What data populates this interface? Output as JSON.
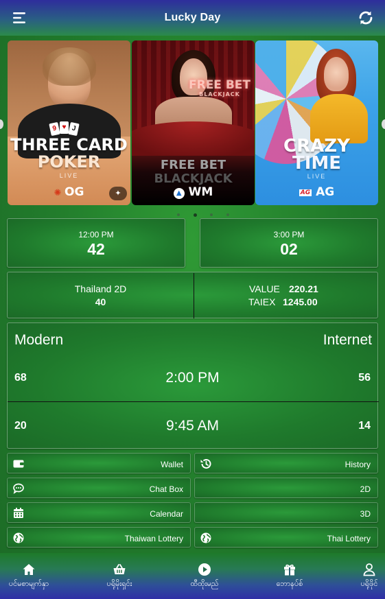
{
  "header": {
    "title": "Lucky Day"
  },
  "banner": {
    "cards": [
      {
        "title_line1": "THREE CARD",
        "title_line2": "POKER",
        "sub": "LIVE",
        "brand": "OG"
      },
      {
        "title_line1": "FREE BET",
        "title_line2": "BLACKJACK",
        "sign": "FREE BET",
        "sign_sub": "BLACKJACK",
        "brand": "WM"
      },
      {
        "title_line1": "CRAZY",
        "title_line2": "TIME",
        "sub": "LIVE",
        "brand_prefix": "AG",
        "brand": "AG"
      }
    ],
    "active_dot": 1,
    "dot_count": 4
  },
  "results": [
    {
      "time": "12:00 PM",
      "number": "42"
    },
    {
      "time": "3:00 PM",
      "number": "02"
    }
  ],
  "info": {
    "left_label": "Thailand 2D",
    "left_value": "40",
    "value_label": "VALUE",
    "value_number": "220.21",
    "taiex_label": "TAIEX",
    "taiex_number": "1245.00"
  },
  "draws": {
    "left_header": "Modern",
    "right_header": "Internet",
    "rows": [
      {
        "left": "68",
        "time": "2:00 PM",
        "right": "56"
      },
      {
        "left": "20",
        "time": "9:45 AM",
        "right": "14"
      }
    ]
  },
  "menu": [
    {
      "label": "Wallet",
      "icon": "wallet-icon"
    },
    {
      "label": "History",
      "icon": "history-icon"
    },
    {
      "label": "Chat Box",
      "icon": "chat-icon"
    },
    {
      "label": "2D",
      "icon": ""
    },
    {
      "label": "Calendar",
      "icon": "calendar-icon"
    },
    {
      "label": "3D",
      "icon": ""
    },
    {
      "label": "Thaiwan Lottery",
      "icon": "globe-icon"
    },
    {
      "label": "Thai Lottery",
      "icon": "globe-icon"
    }
  ],
  "nav": [
    {
      "label": "ပင်မစာမျက်နှာ",
      "icon": "home-icon"
    },
    {
      "label": "ပရိုမိုးရှင်း",
      "icon": "basket-icon"
    },
    {
      "label": "ထီထိုးမည်",
      "icon": "play-icon"
    },
    {
      "label": "ဘောနပ်စ်",
      "icon": "gift-icon"
    },
    {
      "label": "ပရိုဖိုင်",
      "icon": "user-icon"
    }
  ],
  "colors": {
    "header_top": "#2e2d9c",
    "panel_green": "#1f7a2c",
    "nav_bottom": "#2f2ea6"
  }
}
